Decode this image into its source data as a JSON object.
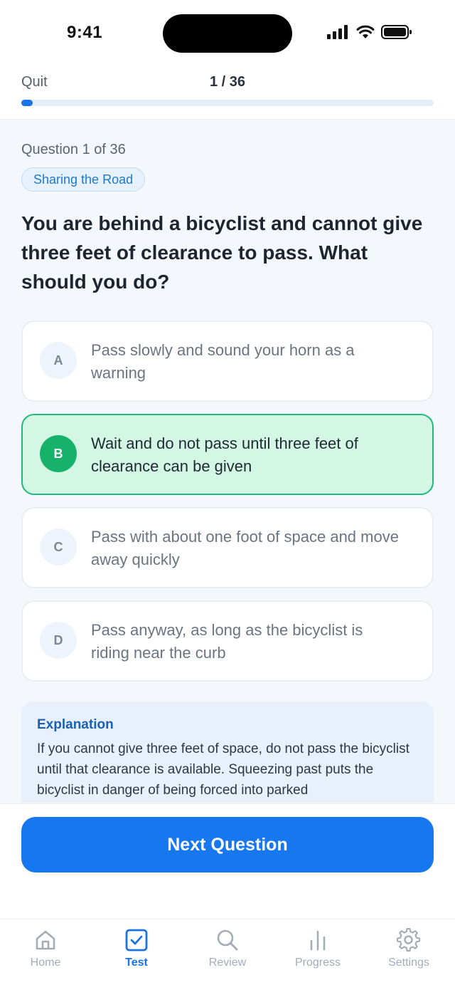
{
  "status_bar": {
    "time": "9:41"
  },
  "top_bar": {
    "quit_label": "Quit",
    "progress_text": "1 / 36",
    "progress_fraction": 0.0278
  },
  "question": {
    "counter": "Question 1 of 36",
    "category": "Sharing the Road",
    "text": "You are behind a bicyclist and cannot give three feet of clearance to pass. What should you do?"
  },
  "options": [
    {
      "letter": "A",
      "text": "Pass slowly and sound your horn as a warning",
      "selected": false
    },
    {
      "letter": "B",
      "text": "Wait and do not pass until three feet of clearance can be given",
      "selected": true
    },
    {
      "letter": "C",
      "text": "Pass with about one foot of space and move away quickly",
      "selected": false
    },
    {
      "letter": "D",
      "text": "Pass anyway, as long as the bicyclist is riding near the curb",
      "selected": false
    }
  ],
  "explanation": {
    "title": "Explanation",
    "body": "If you cannot give three feet of space, do not pass the bicyclist until that clearance is available. Squeezing past puts the bicyclist in danger of being forced into parked"
  },
  "next_button_label": "Next Question",
  "tabs": [
    {
      "label": "Home",
      "icon": "home-icon",
      "active": false
    },
    {
      "label": "Test",
      "icon": "test-checkbox-icon",
      "active": true
    },
    {
      "label": "Review",
      "icon": "search-icon",
      "active": false
    },
    {
      "label": "Progress",
      "icon": "bar-chart-icon",
      "active": false
    },
    {
      "label": "Settings",
      "icon": "gear-icon",
      "active": false
    }
  ],
  "colors": {
    "accent": "#1a73e8",
    "selected_bg": "#d3f7e4",
    "selected_border": "#1fb979"
  }
}
